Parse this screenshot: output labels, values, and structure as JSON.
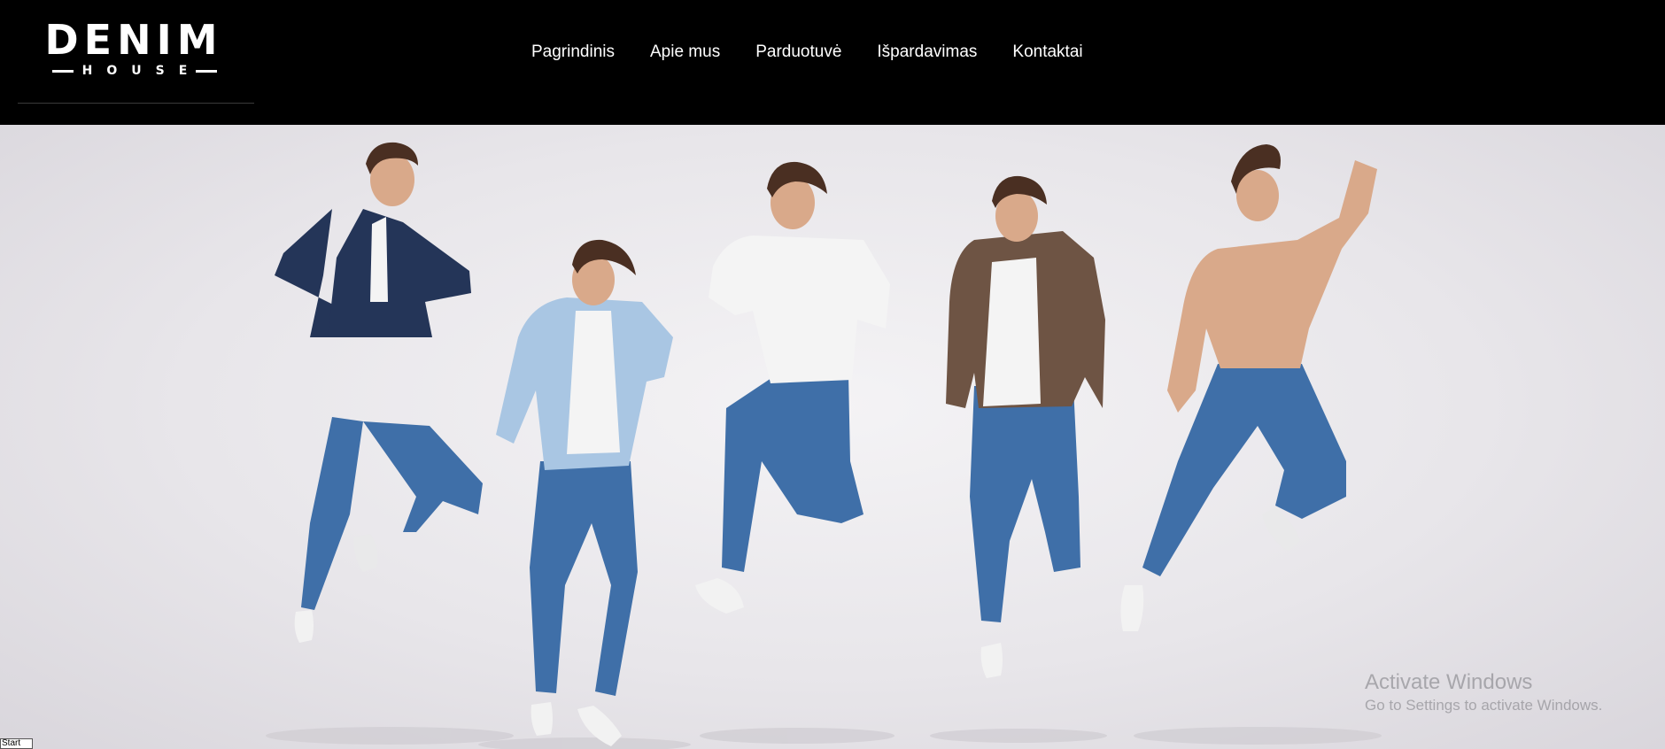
{
  "logo": {
    "main": "DENIM",
    "sub": "HOUSE"
  },
  "nav": {
    "items": [
      {
        "label": "Pagrindinis"
      },
      {
        "label": "Apie mus"
      },
      {
        "label": "Parduotuvė"
      },
      {
        "label": "Išpardavimas"
      },
      {
        "label": "Kontaktai"
      }
    ]
  },
  "hero": {
    "image": "men-jumping-in-denim-jeans-photo",
    "colors": {
      "denim": "#3f6fa8",
      "navy_blazer": "#243558",
      "light_denim": "#a9c6e3",
      "brown_jacket": "#6e5444",
      "skin": "#d9a98a",
      "hair": "#4a2f22"
    }
  },
  "watermark": {
    "title": "Activate Windows",
    "subtitle": "Go to Settings to activate Windows."
  },
  "taskbar": {
    "start_label": "Start"
  }
}
